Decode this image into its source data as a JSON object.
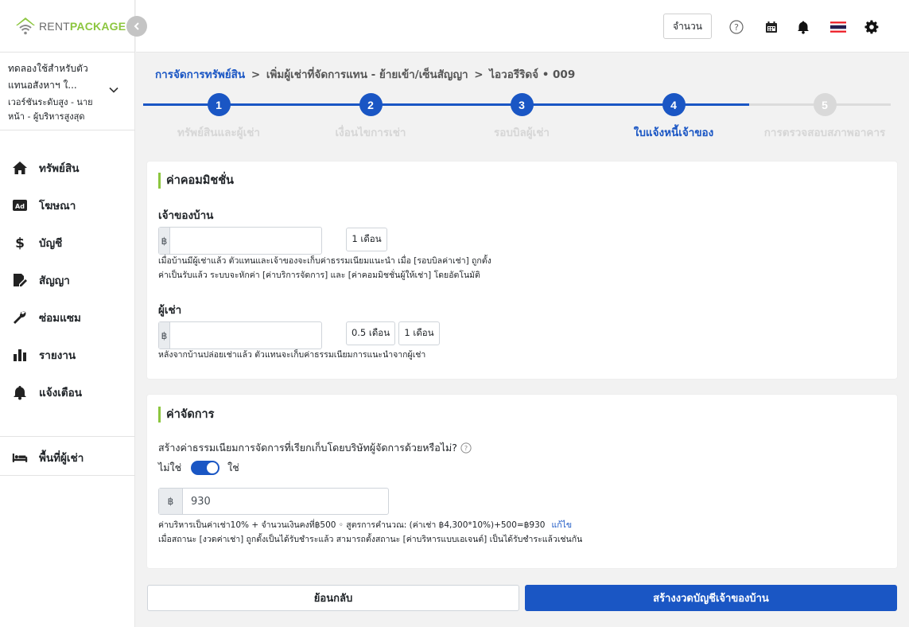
{
  "brand": {
    "name_part1": "RENT",
    "name_part2": "PACKAGE",
    "accent": "#8cc63f",
    "primary": "#1a56c4"
  },
  "account": {
    "name": "ทดลองใช้สำหรับตัวแทนอสังหาฯ ใ...",
    "role": "เวอร์ชันระดับสูง - นายหน้า - ผู้บริหารสูงสุด"
  },
  "sidebar": {
    "items": [
      {
        "label": "ทรัพย์สิน",
        "icon": "home-icon"
      },
      {
        "label": "โฆษณา",
        "icon": "ad-icon"
      },
      {
        "label": "บัญชี",
        "icon": "dollar-icon"
      },
      {
        "label": "สัญญา",
        "icon": "contract-icon"
      },
      {
        "label": "ซ่อมแซม",
        "icon": "wrench-icon"
      },
      {
        "label": "รายงาน",
        "icon": "chart-bar-icon"
      },
      {
        "label": "แจ้งเตือน",
        "icon": "bell-icon"
      }
    ],
    "tenant_area": {
      "label": "พื้นที่ผู้เช่า",
      "icon": "bed-icon"
    }
  },
  "topbar": {
    "amount_button": "จำนวน",
    "icons": [
      "help-icon",
      "calendar-icon",
      "bell-icon",
      "thai-flag-icon",
      "gear-icon"
    ]
  },
  "breadcrumb": {
    "root": "การจัดการทรัพย์สิน",
    "sep": ">",
    "middle": "เพิ่มผู้เช่าที่จัดการแทน - ย้ายเข้า/เซ็นสัญญา",
    "current": "ไอวอรีริดจ์ • 009"
  },
  "stepper": {
    "current": 4,
    "steps": [
      {
        "num": "1",
        "label": "ทรัพย์สินและผู้เช่า"
      },
      {
        "num": "2",
        "label": "เงื่อนไขการเช่า"
      },
      {
        "num": "3",
        "label": "รอบบิลผู้เช่า"
      },
      {
        "num": "4",
        "label": "ใบแจ้งหนี้เจ้าของ"
      },
      {
        "num": "5",
        "label": "การตรวจสอบสภาพอาคาร"
      }
    ]
  },
  "commission": {
    "title": "ค่าคอมมิชชั่น",
    "owner": {
      "label": "เจ้าของบ้าน",
      "currency": "฿",
      "value": "",
      "chip": "1 เดือน",
      "help_line1": "เมื่อบ้านมีผู้เช่าแล้ว ตัวแทนและเจ้าของจะเก็บค่าธรรมเนียมแนะนำ เมื่อ [รอบบิลค่าเช่า] ถูกตั้ง",
      "help_line2": "ค่าเป็นรับแล้ว ระบบจะหักค่า [ค่าบริการจัดการ] และ [ค่าคอมมิชชั่นผู้ให้เช่า] โดยอัตโนมัติ"
    },
    "tenant": {
      "label": "ผู้เช่า",
      "currency": "฿",
      "value": "",
      "chip1": "0.5 เดือน",
      "chip2": "1 เดือน",
      "help": "หลังจากบ้านปล่อยเช่าแล้ว ตัวแทนจะเก็บค่าธรรมเนียมการแนะนำจากผู้เช่า"
    }
  },
  "management": {
    "title": "ค่าจัดการ",
    "question": "สร้างค่าธรรมเนียมการจัดการที่เรียกเก็บโดยบริษัทผู้จัดการด้วยหรือไม่?",
    "toggle_no": "ไม่ใช่",
    "toggle_yes": "ใช่",
    "toggle_on": true,
    "currency": "฿",
    "value": "930",
    "help_line1": "ค่าบริหารเป็นค่าเช่า10% + จำนวนเงินคงที่฿500 ◦ สูตรการคำนวณ: (ค่าเช่า ฿4,300*10%)+500=฿930",
    "edit_link": "แก้ไข",
    "help_line2": "เมื่อสถานะ [งวดค่าเช่า] ถูกตั้งเป็นได้รับชำระแล้ว สามารถตั้งสถานะ [ค่าบริหารแบบเอเจนต์] เป็นได้รับชำระแล้วเช่นกัน"
  },
  "actions": {
    "back": "ย้อนกลับ",
    "submit": "สร้างงวดบัญชีเจ้าของบ้าน"
  }
}
